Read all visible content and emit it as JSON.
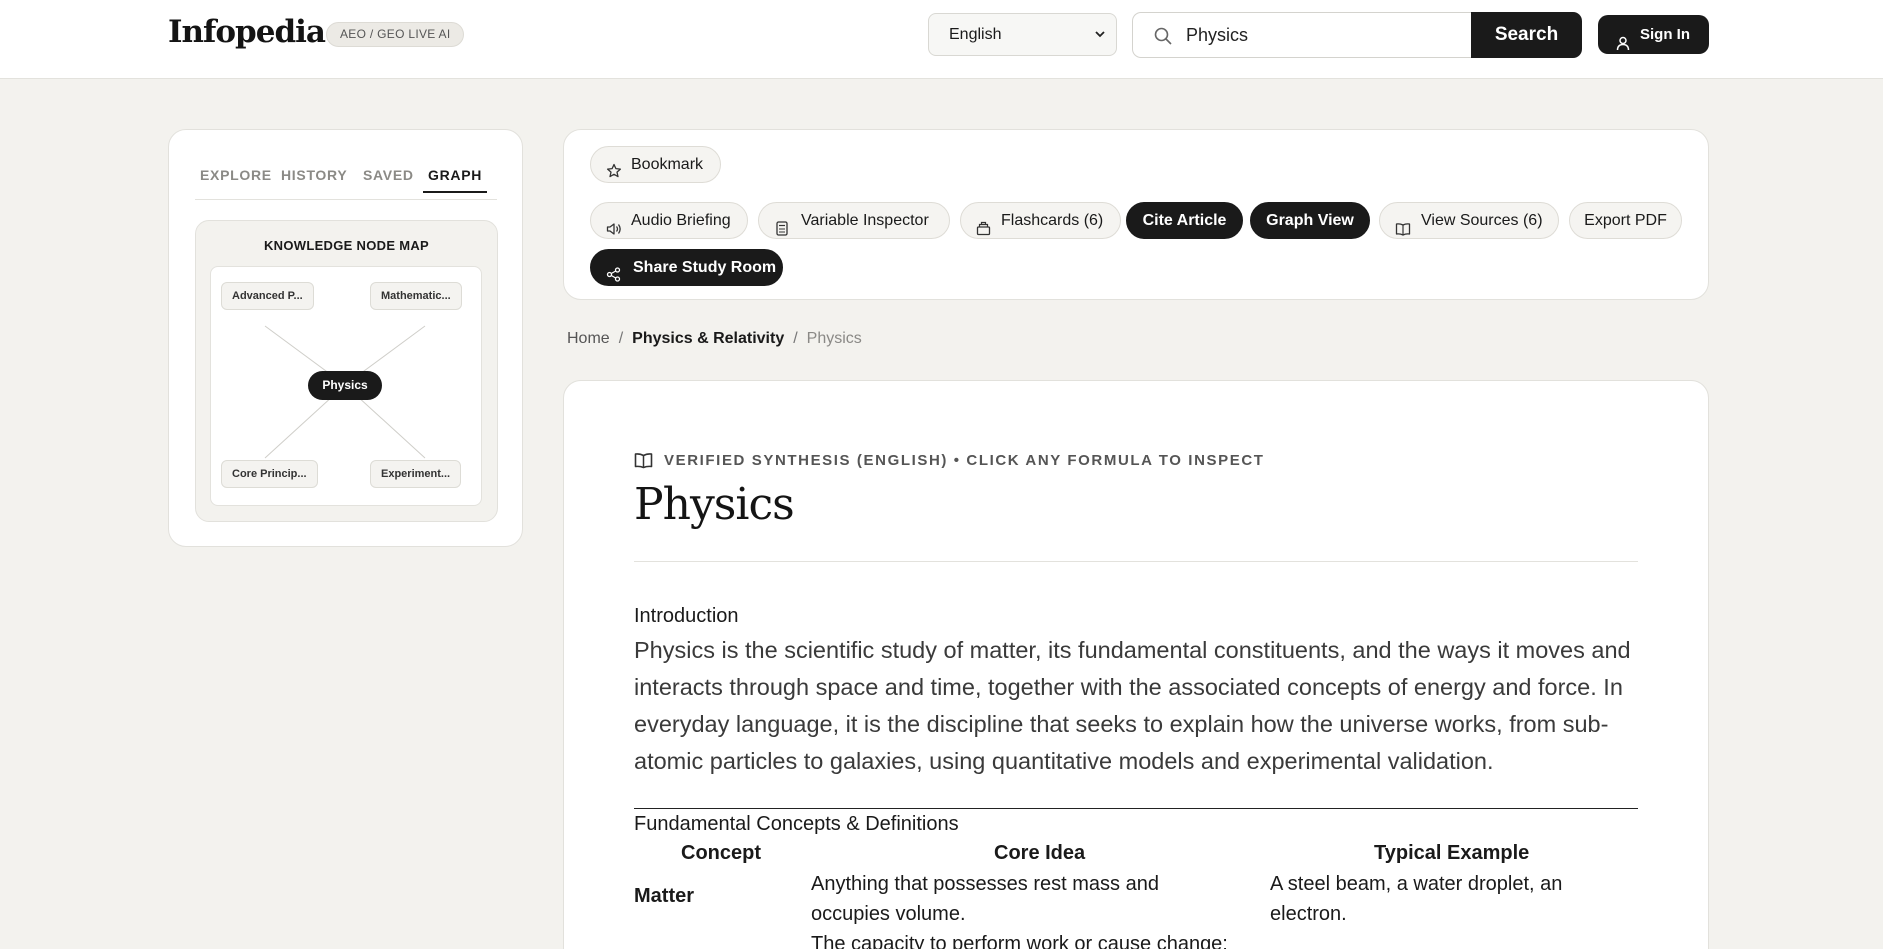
{
  "header": {
    "logo": "Infopedia",
    "badge": "AEO / GEO LIVE AI",
    "language": "English",
    "search_value": "Physics",
    "search_button": "Search",
    "signin_label": "Sign In"
  },
  "sidebar": {
    "tabs": [
      "EXPLORE",
      "HISTORY",
      "SAVED",
      "GRAPH"
    ],
    "active_tab": "GRAPH",
    "map_title": "KNOWLEDGE NODE MAP",
    "center_node": "Physics",
    "nodes": [
      "Advanced P...",
      "Mathematic...",
      "Core Princip...",
      "Experiment..."
    ]
  },
  "toolbar": {
    "bookmark": "Bookmark",
    "audio": "Audio Briefing",
    "variable": "Variable Inspector",
    "flashcards": "Flashcards (6)",
    "cite": "Cite Article",
    "graph": "Graph View",
    "sources": "View Sources (6)",
    "export": "Export PDF",
    "share": "Share Study Room"
  },
  "breadcrumb": {
    "home": "Home",
    "sep": "/",
    "category": "Physics & Relativity",
    "current": "Physics"
  },
  "article": {
    "verified": "VERIFIED SYNTHESIS (ENGLISH) • CLICK ANY FORMULA TO INSPECT",
    "title": "Physics",
    "intro_heading": "Introduction",
    "intro_text": "Physics is the scientific study of matter, its fundamental constituents, and the ways it moves and interacts through space and time, together with the associated concepts of energy and force. In everyday language, it is the discipline that seeks to explain how the universe works, from sub-atomic particles to galaxies, using quantitative models and experimental validation.",
    "section_heading": "Fundamental Concepts & Definitions",
    "table": {
      "headers": [
        "Concept",
        "Core Idea",
        "Typical Example"
      ],
      "rows": [
        {
          "concept": "Matter",
          "core_line1": "Anything that possesses rest mass and",
          "core_line2": "occupies volume.",
          "example_line1": "A steel beam, a water droplet, an",
          "example_line2": "electron."
        }
      ],
      "next_row_partial": "The capacity to perform work or cause change;"
    }
  },
  "colors": {
    "background": "#f3f2ee",
    "card": "#ffffff",
    "dark": "#1a1a1a",
    "border": "#e2e1dc"
  }
}
